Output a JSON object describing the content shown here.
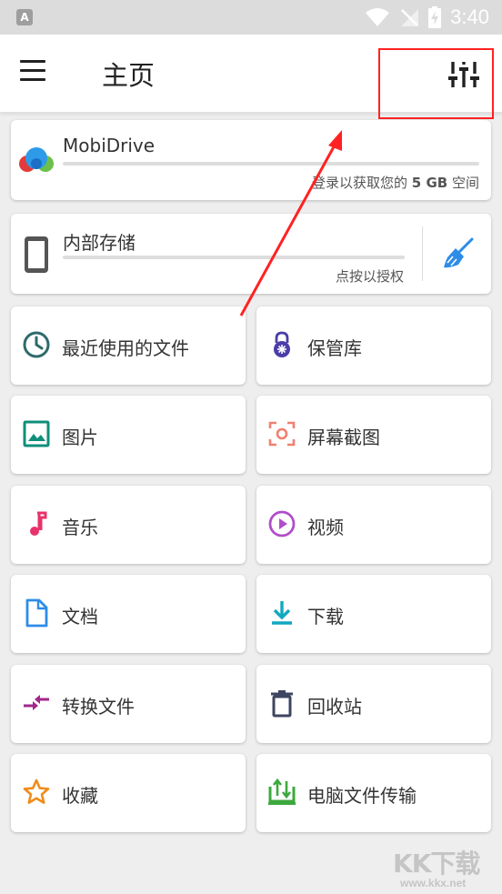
{
  "status_bar": {
    "time": "3:40",
    "left_icon": "A"
  },
  "app_bar": {
    "title": "主页",
    "menu_icon": "hamburger-menu-icon",
    "filter_icon": "tune-sliders-icon"
  },
  "mobidrive": {
    "name": "MobiDrive",
    "note_pre": "登录以获取您的",
    "note_bold": "5 GB",
    "note_post": "空间"
  },
  "internal_storage": {
    "name": "内部存储",
    "note": "点按以授权"
  },
  "tiles": [
    {
      "label": "最近使用的文件",
      "icon": "clock-icon",
      "color": "#2e6b6b"
    },
    {
      "label": "保管库",
      "icon": "lock-icon",
      "color": "#4a3da8"
    },
    {
      "label": "图片",
      "icon": "image-icon",
      "color": "#0f8f7a"
    },
    {
      "label": "屏幕截图",
      "icon": "screenshot-icon",
      "color": "#f08070"
    },
    {
      "label": "音乐",
      "icon": "music-note-icon",
      "color": "#e8336b"
    },
    {
      "label": "视频",
      "icon": "play-circle-icon",
      "color": "#b04ec8"
    },
    {
      "label": "文档",
      "icon": "document-icon",
      "color": "#2d8ce8"
    },
    {
      "label": "下载",
      "icon": "download-icon",
      "color": "#12a8c0"
    },
    {
      "label": "转换文件",
      "icon": "convert-arrows-icon",
      "color": "#a0288a"
    },
    {
      "label": "回收站",
      "icon": "trash-icon",
      "color": "#3d4560"
    },
    {
      "label": "收藏",
      "icon": "star-icon",
      "color": "#f08c1a"
    },
    {
      "label": "电脑文件传输",
      "icon": "pc-transfer-icon",
      "color": "#3da83d"
    }
  ],
  "watermark": {
    "text": "KK下载",
    "url": "www.kkx.net"
  }
}
